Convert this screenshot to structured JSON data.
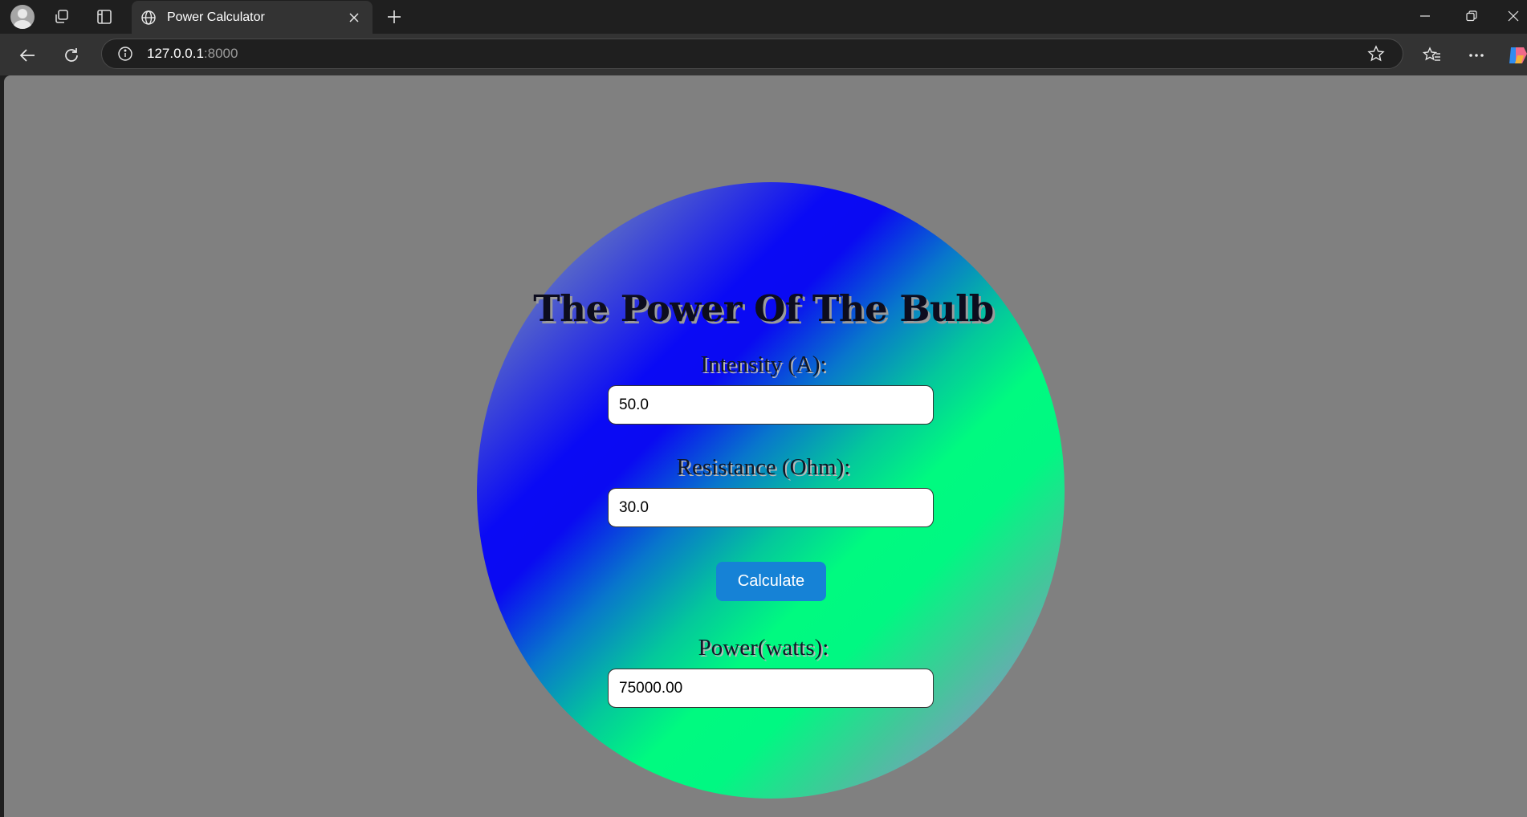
{
  "browser": {
    "tab": {
      "title": "Power Calculator"
    },
    "address_bar": {
      "host": "127.0.0.1",
      "port": ":8000"
    }
  },
  "page": {
    "title": "The Power Of The Bulb",
    "intensity": {
      "label": "Intensity (A):",
      "value": "50.0"
    },
    "resistance": {
      "label": "Resistance (Ohm):",
      "value": "30.0"
    },
    "calculate_label": "Calculate",
    "power": {
      "label": "Power(watts):",
      "value": "75000.00"
    },
    "colors": {
      "background": "#808080",
      "button": "#1682d6",
      "gradient": [
        "#8d8d9a",
        "#0a0af5",
        "#00fa80",
        "#9a90cc"
      ]
    }
  }
}
